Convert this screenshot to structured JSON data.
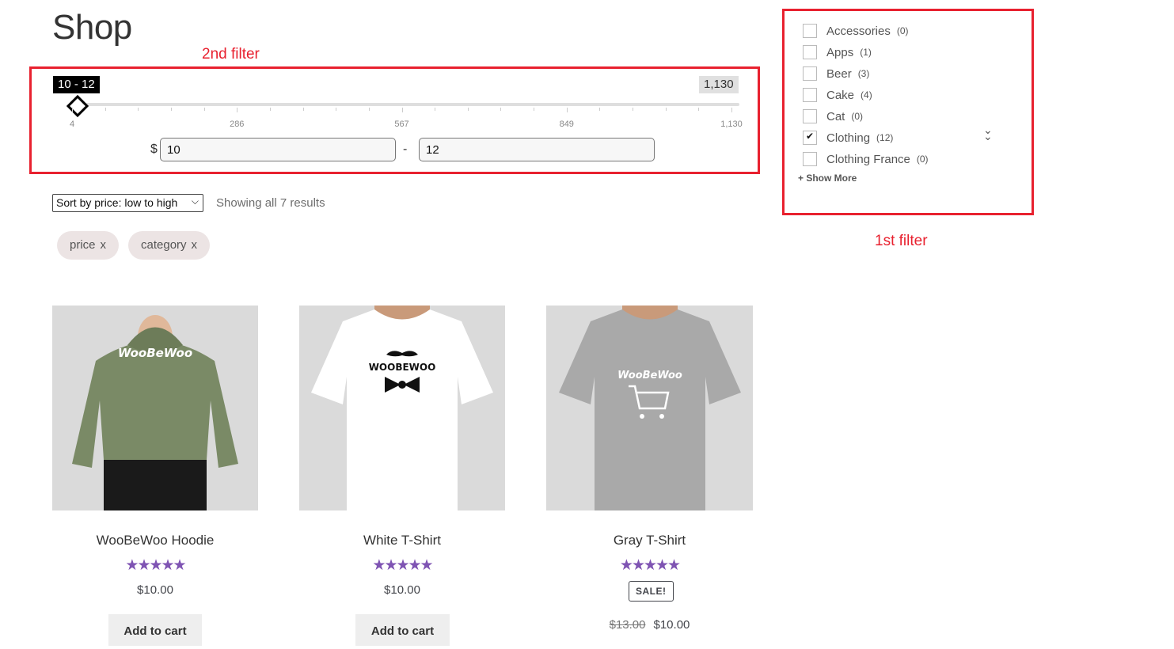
{
  "page": {
    "title": "Shop"
  },
  "annotations": {
    "second_filter": "2nd filter",
    "first_filter": "1st filter"
  },
  "price_filter": {
    "range_badge": "10 - 12",
    "max_badge": "1,130",
    "currency": "$",
    "min_value": "10",
    "max_value": "12",
    "dash": "-",
    "ticks": [
      "4",
      "286",
      "567",
      "849",
      "1,130"
    ],
    "slider_min": 4,
    "slider_max": 1130
  },
  "sorting": {
    "selected": "Sort by price: low to high",
    "result_count": "Showing all 7 results"
  },
  "active_filters": [
    {
      "label": "price",
      "remove": "x"
    },
    {
      "label": "category",
      "remove": "x"
    }
  ],
  "products": [
    {
      "title": "WooBeWoo Hoodie",
      "stars": "★★★★★",
      "price": "$10.00",
      "button": "Add to cart",
      "image_text": "WooBeWoo",
      "color": "#7a8a66"
    },
    {
      "title": "White T-Shirt",
      "stars": "★★★★★",
      "price": "$10.00",
      "button": "Add to cart",
      "image_text": "WOOBEWOO",
      "color": "#ffffff"
    },
    {
      "title": "Gray T-Shirt",
      "stars": "★★★★★",
      "sale": "SALE!",
      "old_price": "$13.00",
      "price": "$10.00",
      "button": "",
      "image_text": "WooBeWoo",
      "color": "#a9a9a9"
    }
  ],
  "category_filter": {
    "items": [
      {
        "label": "Accessories",
        "count": "(0)",
        "checked": false
      },
      {
        "label": "Apps",
        "count": "(1)",
        "checked": false
      },
      {
        "label": "Beer",
        "count": "(3)",
        "checked": false
      },
      {
        "label": "Cake",
        "count": "(4)",
        "checked": false
      },
      {
        "label": "Cat",
        "count": "(0)",
        "checked": false
      },
      {
        "label": "Clothing",
        "count": "(12)",
        "checked": true
      },
      {
        "label": "Clothing France",
        "count": "(0)",
        "checked": false
      }
    ],
    "show_more": "+ Show More"
  },
  "colors": {
    "annotation": "#e8212f",
    "stars": "#7f54b3"
  },
  "icons": {
    "collapse": "double-chevron-down-icon",
    "sort": "chevron-down-icon"
  }
}
